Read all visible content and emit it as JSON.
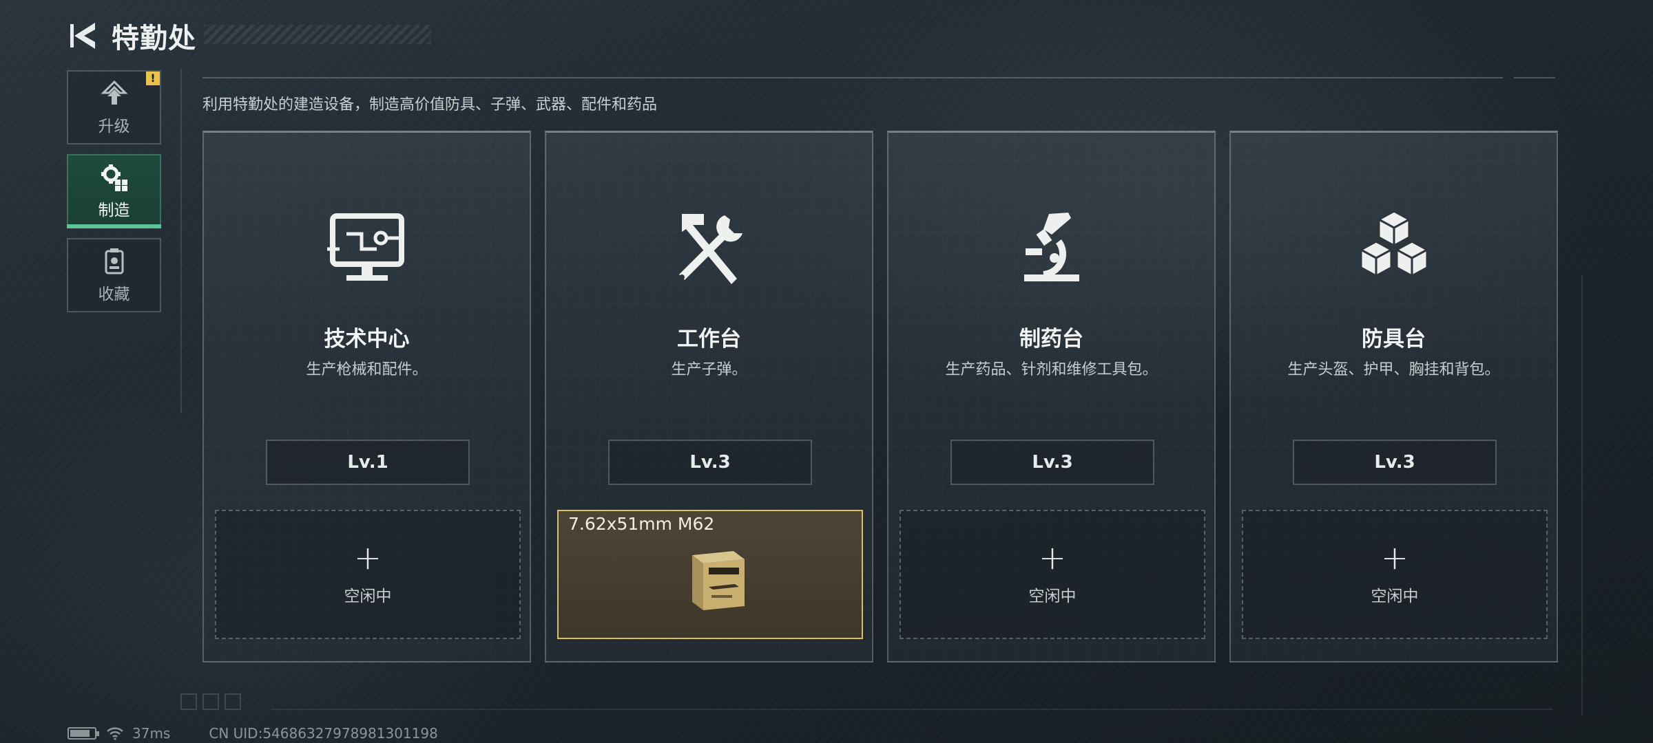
{
  "header": {
    "title": "特勤处",
    "back_icon": "back-arrow-icon"
  },
  "sidebar": {
    "items": [
      {
        "label": "升级",
        "icon": "upgrade-icon",
        "active": false,
        "alert": "!"
      },
      {
        "label": "制造",
        "icon": "gears-icon",
        "active": true
      },
      {
        "label": "收藏",
        "icon": "collection-icon",
        "active": false
      }
    ]
  },
  "main": {
    "subtitle": "利用特勤处的建造设备，制造高价值防具、子弹、武器、配件和药品",
    "stations": [
      {
        "title": "技术中心",
        "desc": "生产枪械和配件。",
        "level": "Lv.1",
        "icon": "computer-icon",
        "slot": {
          "plus": "+",
          "status": "空闲中"
        }
      },
      {
        "title": "工作台",
        "desc": "生产子弹。",
        "level": "Lv.3",
        "icon": "hammer-wrench-icon",
        "slot": {
          "item": "7.62x51mm M62",
          "item_icon": "ammo-box-icon"
        }
      },
      {
        "title": "制药台",
        "desc": "生产药品、针剂和维修工具包。",
        "level": "Lv.3",
        "icon": "microscope-icon",
        "slot": {
          "plus": "+",
          "status": "空闲中"
        }
      },
      {
        "title": "防具台",
        "desc": "生产头盔、护甲、胸挂和背包。",
        "level": "Lv.3",
        "icon": "boxes-icon",
        "slot": {
          "plus": "+",
          "status": "空闲中"
        }
      }
    ]
  },
  "footer": {
    "ping": "37ms",
    "uid": "CN UID:5468632797898130119​8"
  },
  "colors": {
    "accent_green": "#58c596",
    "active_slot_border": "#d9bf6a",
    "alert_yellow": "#e8c24a"
  }
}
